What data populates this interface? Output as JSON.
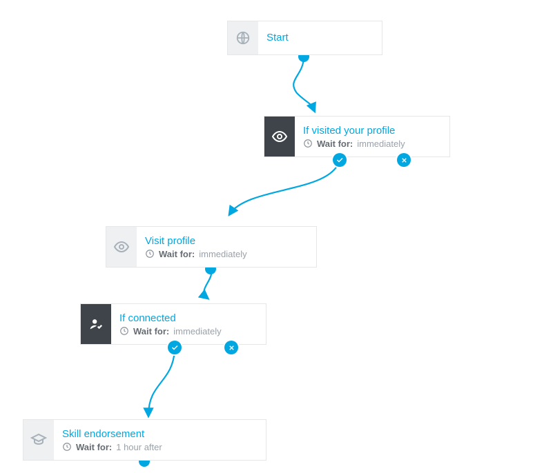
{
  "colors": {
    "accent": "#00a7e1",
    "node_dark": "#3e444a",
    "node_light": "#eef0f2",
    "border": "#e6e6e6",
    "title": "#00a7e1",
    "sub_label": "#676c72",
    "sub_value": "#9aa1a8"
  },
  "nodes": {
    "start": {
      "title": "Start",
      "icon": "globe-icon"
    },
    "visited": {
      "title": "If visited your profile",
      "wait_label": "Wait for:",
      "wait_value": "immediately",
      "icon": "eye-icon"
    },
    "visit": {
      "title": "Visit profile",
      "wait_label": "Wait for:",
      "wait_value": "immediately",
      "icon": "eye-icon"
    },
    "connected": {
      "title": "If connected",
      "wait_label": "Wait for:",
      "wait_value": "immediately",
      "icon": "person-check-icon"
    },
    "skill": {
      "title": "Skill endorsement",
      "wait_label": "Wait for:",
      "wait_value": "1 hour after",
      "icon": "graduation-cap-icon"
    }
  },
  "badges": {
    "check": "✓",
    "cross": "✕"
  }
}
